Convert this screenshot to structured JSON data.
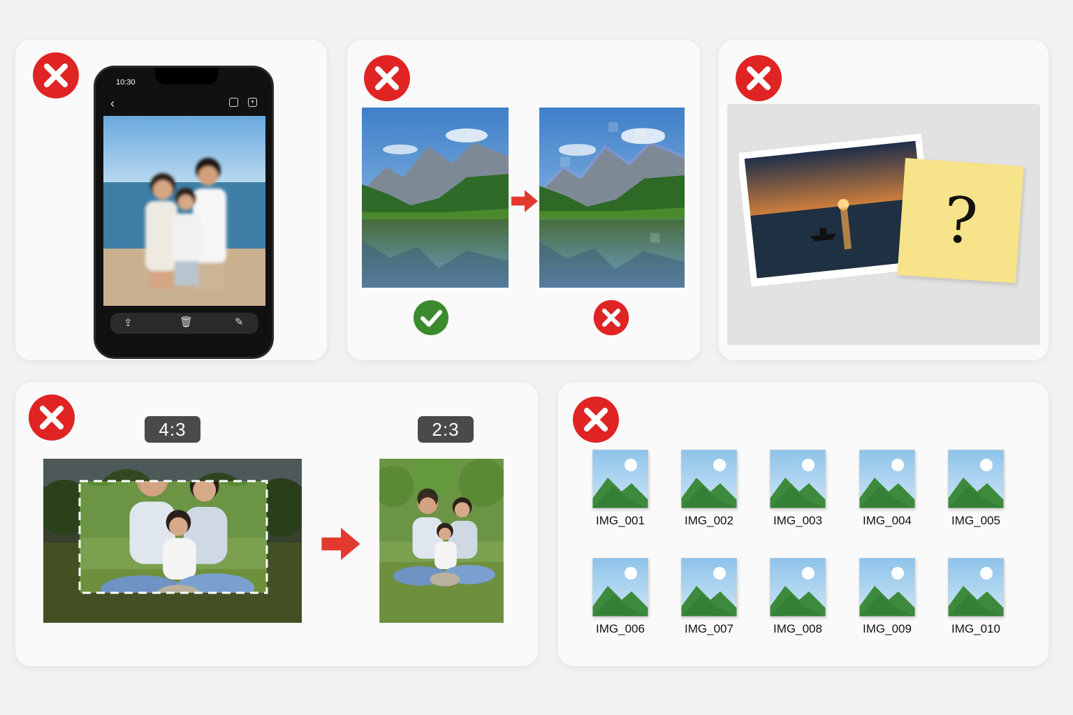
{
  "phone": {
    "time": "10:30"
  },
  "ratios": {
    "source": "4:3",
    "target": "2:3"
  },
  "files": [
    {
      "name": "IMG_001"
    },
    {
      "name": "IMG_002"
    },
    {
      "name": "IMG_003"
    },
    {
      "name": "IMG_004"
    },
    {
      "name": "IMG_005"
    },
    {
      "name": "IMG_006"
    },
    {
      "name": "IMG_007"
    },
    {
      "name": "IMG_008"
    },
    {
      "name": "IMG_009"
    },
    {
      "name": "IMG_010"
    }
  ],
  "note": {
    "symbol": "?"
  },
  "colors": {
    "error_red": "#e02424",
    "ok_green": "#3c8a2e",
    "note_yellow": "#f6e38a",
    "arrow_red": "#e23a2e"
  },
  "icons": [
    "close-x-icon",
    "check-icon",
    "arrow-right-icon",
    "share-icon",
    "trash-icon",
    "edit-icon",
    "back-icon",
    "image-file-icon"
  ]
}
